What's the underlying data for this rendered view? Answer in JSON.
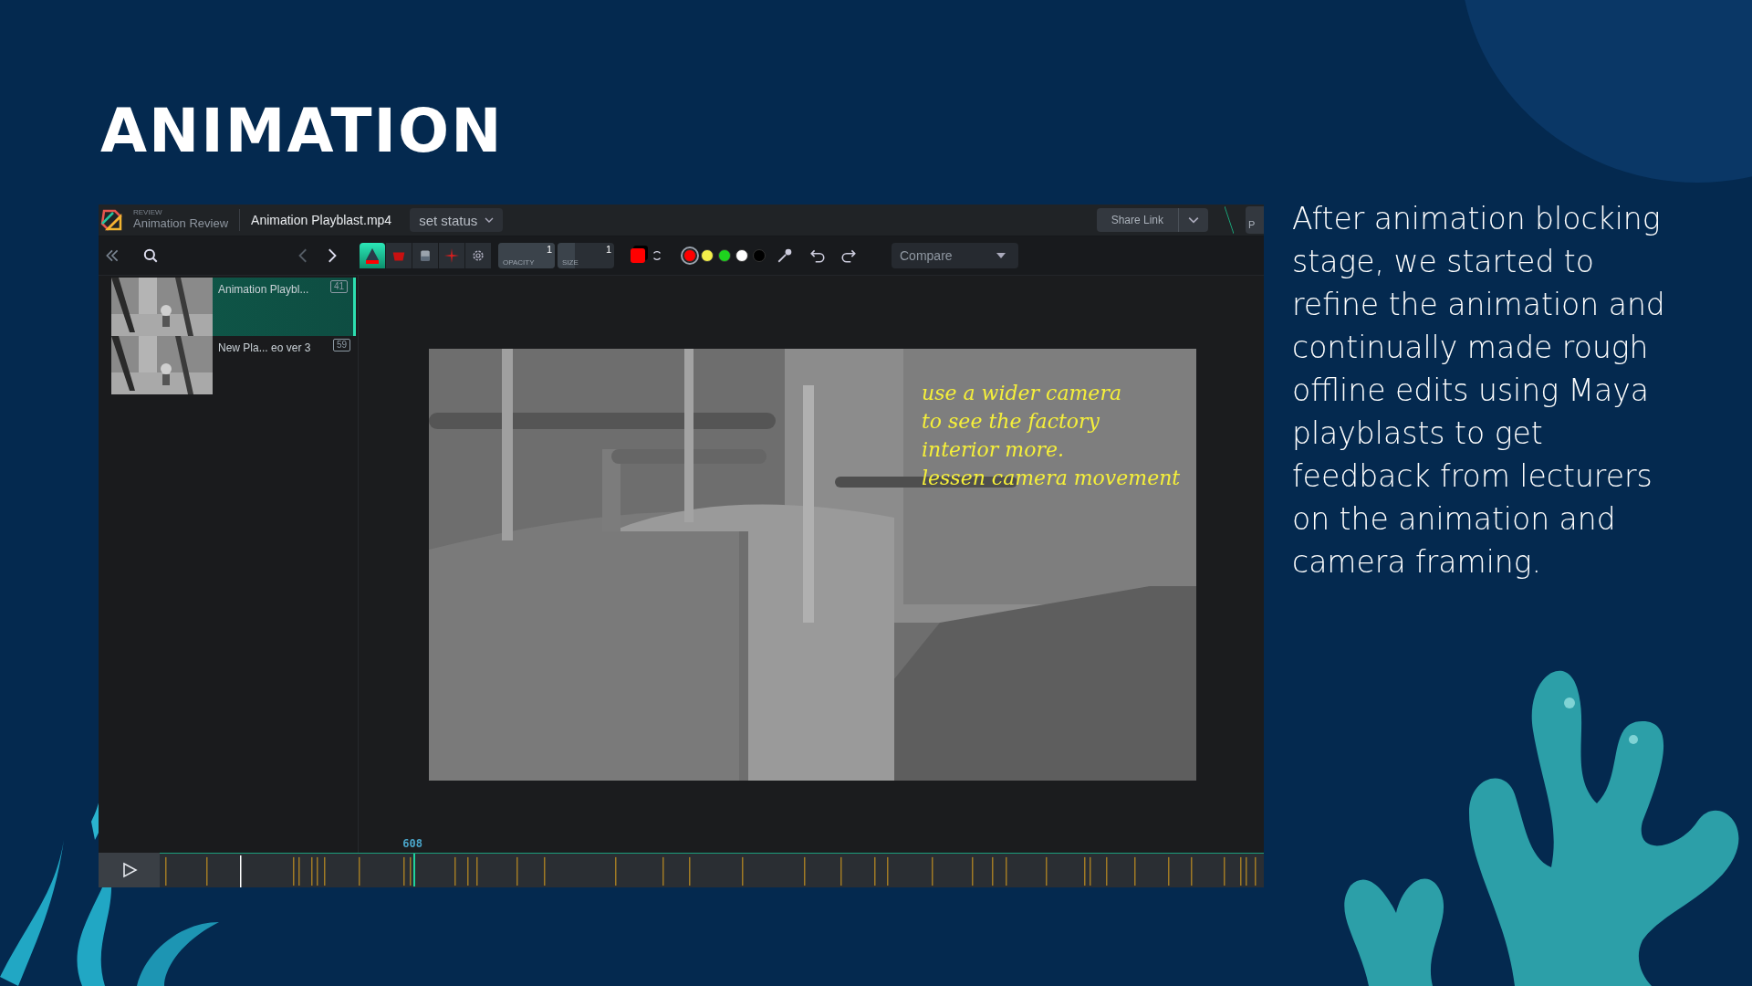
{
  "slide": {
    "title": "ANIMATION",
    "description": "After animation blocking stage, we started to refine the animation and continually made rough offline edits using Maya playblasts to get feedback from lecturers on the animation and camera framing."
  },
  "app": {
    "section_label": "REVIEW",
    "project": "Animation Review",
    "file_name": "Animation Playblast.mp4",
    "status_button": "set status",
    "share_button": "Share Link",
    "cut_button": "P",
    "tools": [
      {
        "kind": "shape",
        "selected": true
      },
      {
        "kind": "fill",
        "selected": false
      },
      {
        "kind": "eraser",
        "selected": false
      },
      {
        "kind": "laser",
        "selected": false
      },
      {
        "kind": "settings",
        "selected": false
      }
    ],
    "opacity": {
      "label": "OPACITY",
      "value": "1",
      "level": 1
    },
    "size": {
      "label": "SIZE",
      "value": "1",
      "level": 0.3
    },
    "colors": [
      {
        "color": "#ff0000",
        "selected": true
      },
      {
        "color": "#f5f04a",
        "selected": false
      },
      {
        "color": "#1ed41e",
        "selected": false
      },
      {
        "color": "#ffffff",
        "selected": false
      },
      {
        "color": "#000000",
        "selected": false
      }
    ],
    "compare": "Compare",
    "playlist": [
      {
        "title": "Animation Playbl...",
        "comments": "41",
        "selected": true
      },
      {
        "title": "New Pla... eo ver 3",
        "comments": "59",
        "selected": false
      }
    ],
    "annotation": [
      "use a wider camera",
      "to see the factory",
      "interior more.",
      "lessen camera movement"
    ],
    "timeline": {
      "frame": "608",
      "level": 0.23
    }
  }
}
